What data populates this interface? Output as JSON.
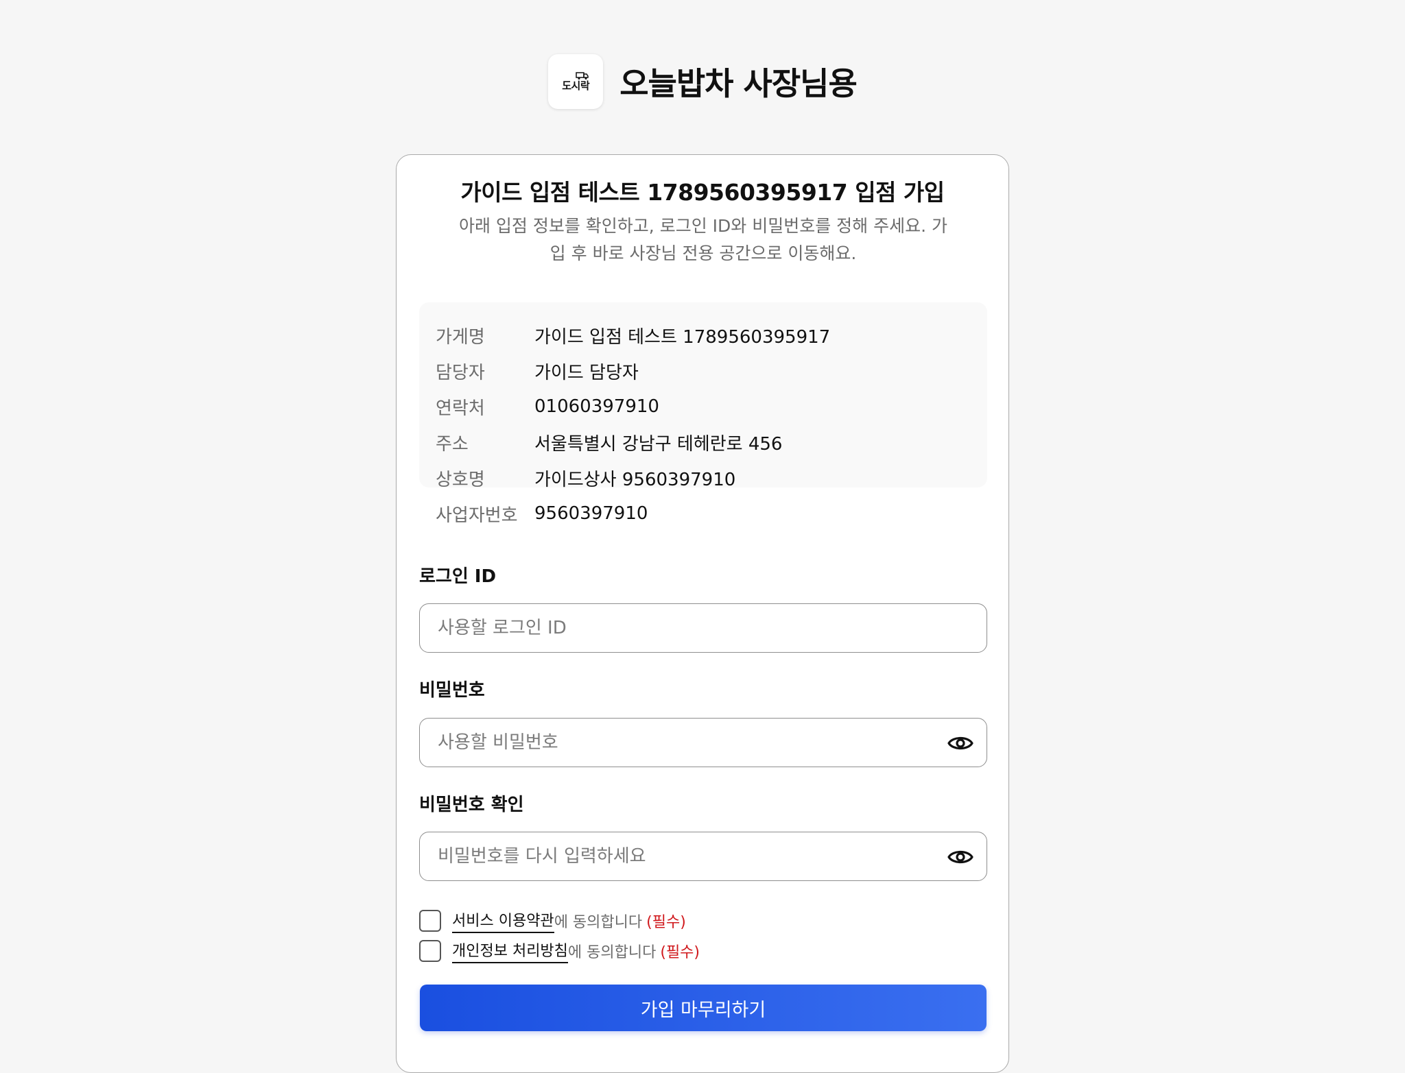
{
  "header": {
    "logo_text": "도시락",
    "app_title": "오늘밥차 사장님용"
  },
  "card": {
    "title": "가이드 입점 테스트 1789560395917 입점 가입",
    "description": "아래 입점 정보를 확인하고, 로그인 ID와 비밀번호를 정해 주세요. 가입 후 바로 사장님 전용 공간으로 이동해요."
  },
  "info": {
    "rows": [
      {
        "label": "가게명",
        "value": "가이드 입점 테스트 1789560395917"
      },
      {
        "label": "담당자",
        "value": "가이드 담당자"
      },
      {
        "label": "연락처",
        "value": "01060397910"
      },
      {
        "label": "주소",
        "value": "서울특별시 강남구 테헤란로 456"
      },
      {
        "label": "상호명",
        "value": "가이드상사 9560397910"
      },
      {
        "label": "사업자번호",
        "value": "9560397910"
      }
    ]
  },
  "form": {
    "login_id": {
      "label": "로그인 ID",
      "placeholder": "사용할 로그인 ID",
      "value": ""
    },
    "password": {
      "label": "비밀번호",
      "placeholder": "사용할 비밀번호",
      "value": ""
    },
    "password_confirm": {
      "label": "비밀번호 확인",
      "placeholder": "비밀번호를 다시 입력하세요",
      "value": ""
    }
  },
  "agreements": [
    {
      "link": "서비스 이용약관",
      "text": "에 동의합니다",
      "required": "(필수)",
      "checked": false
    },
    {
      "link": "개인정보 처리방침",
      "text": "에 동의합니다",
      "required": "(필수)",
      "checked": false
    }
  ],
  "submit_label": "가입 마무리하기",
  "icons": {
    "logo": "lunchbox-truck-icon",
    "password_toggle": "eye-icon"
  },
  "colors": {
    "primary": "#1a4fe0",
    "required": "#d0181c"
  }
}
